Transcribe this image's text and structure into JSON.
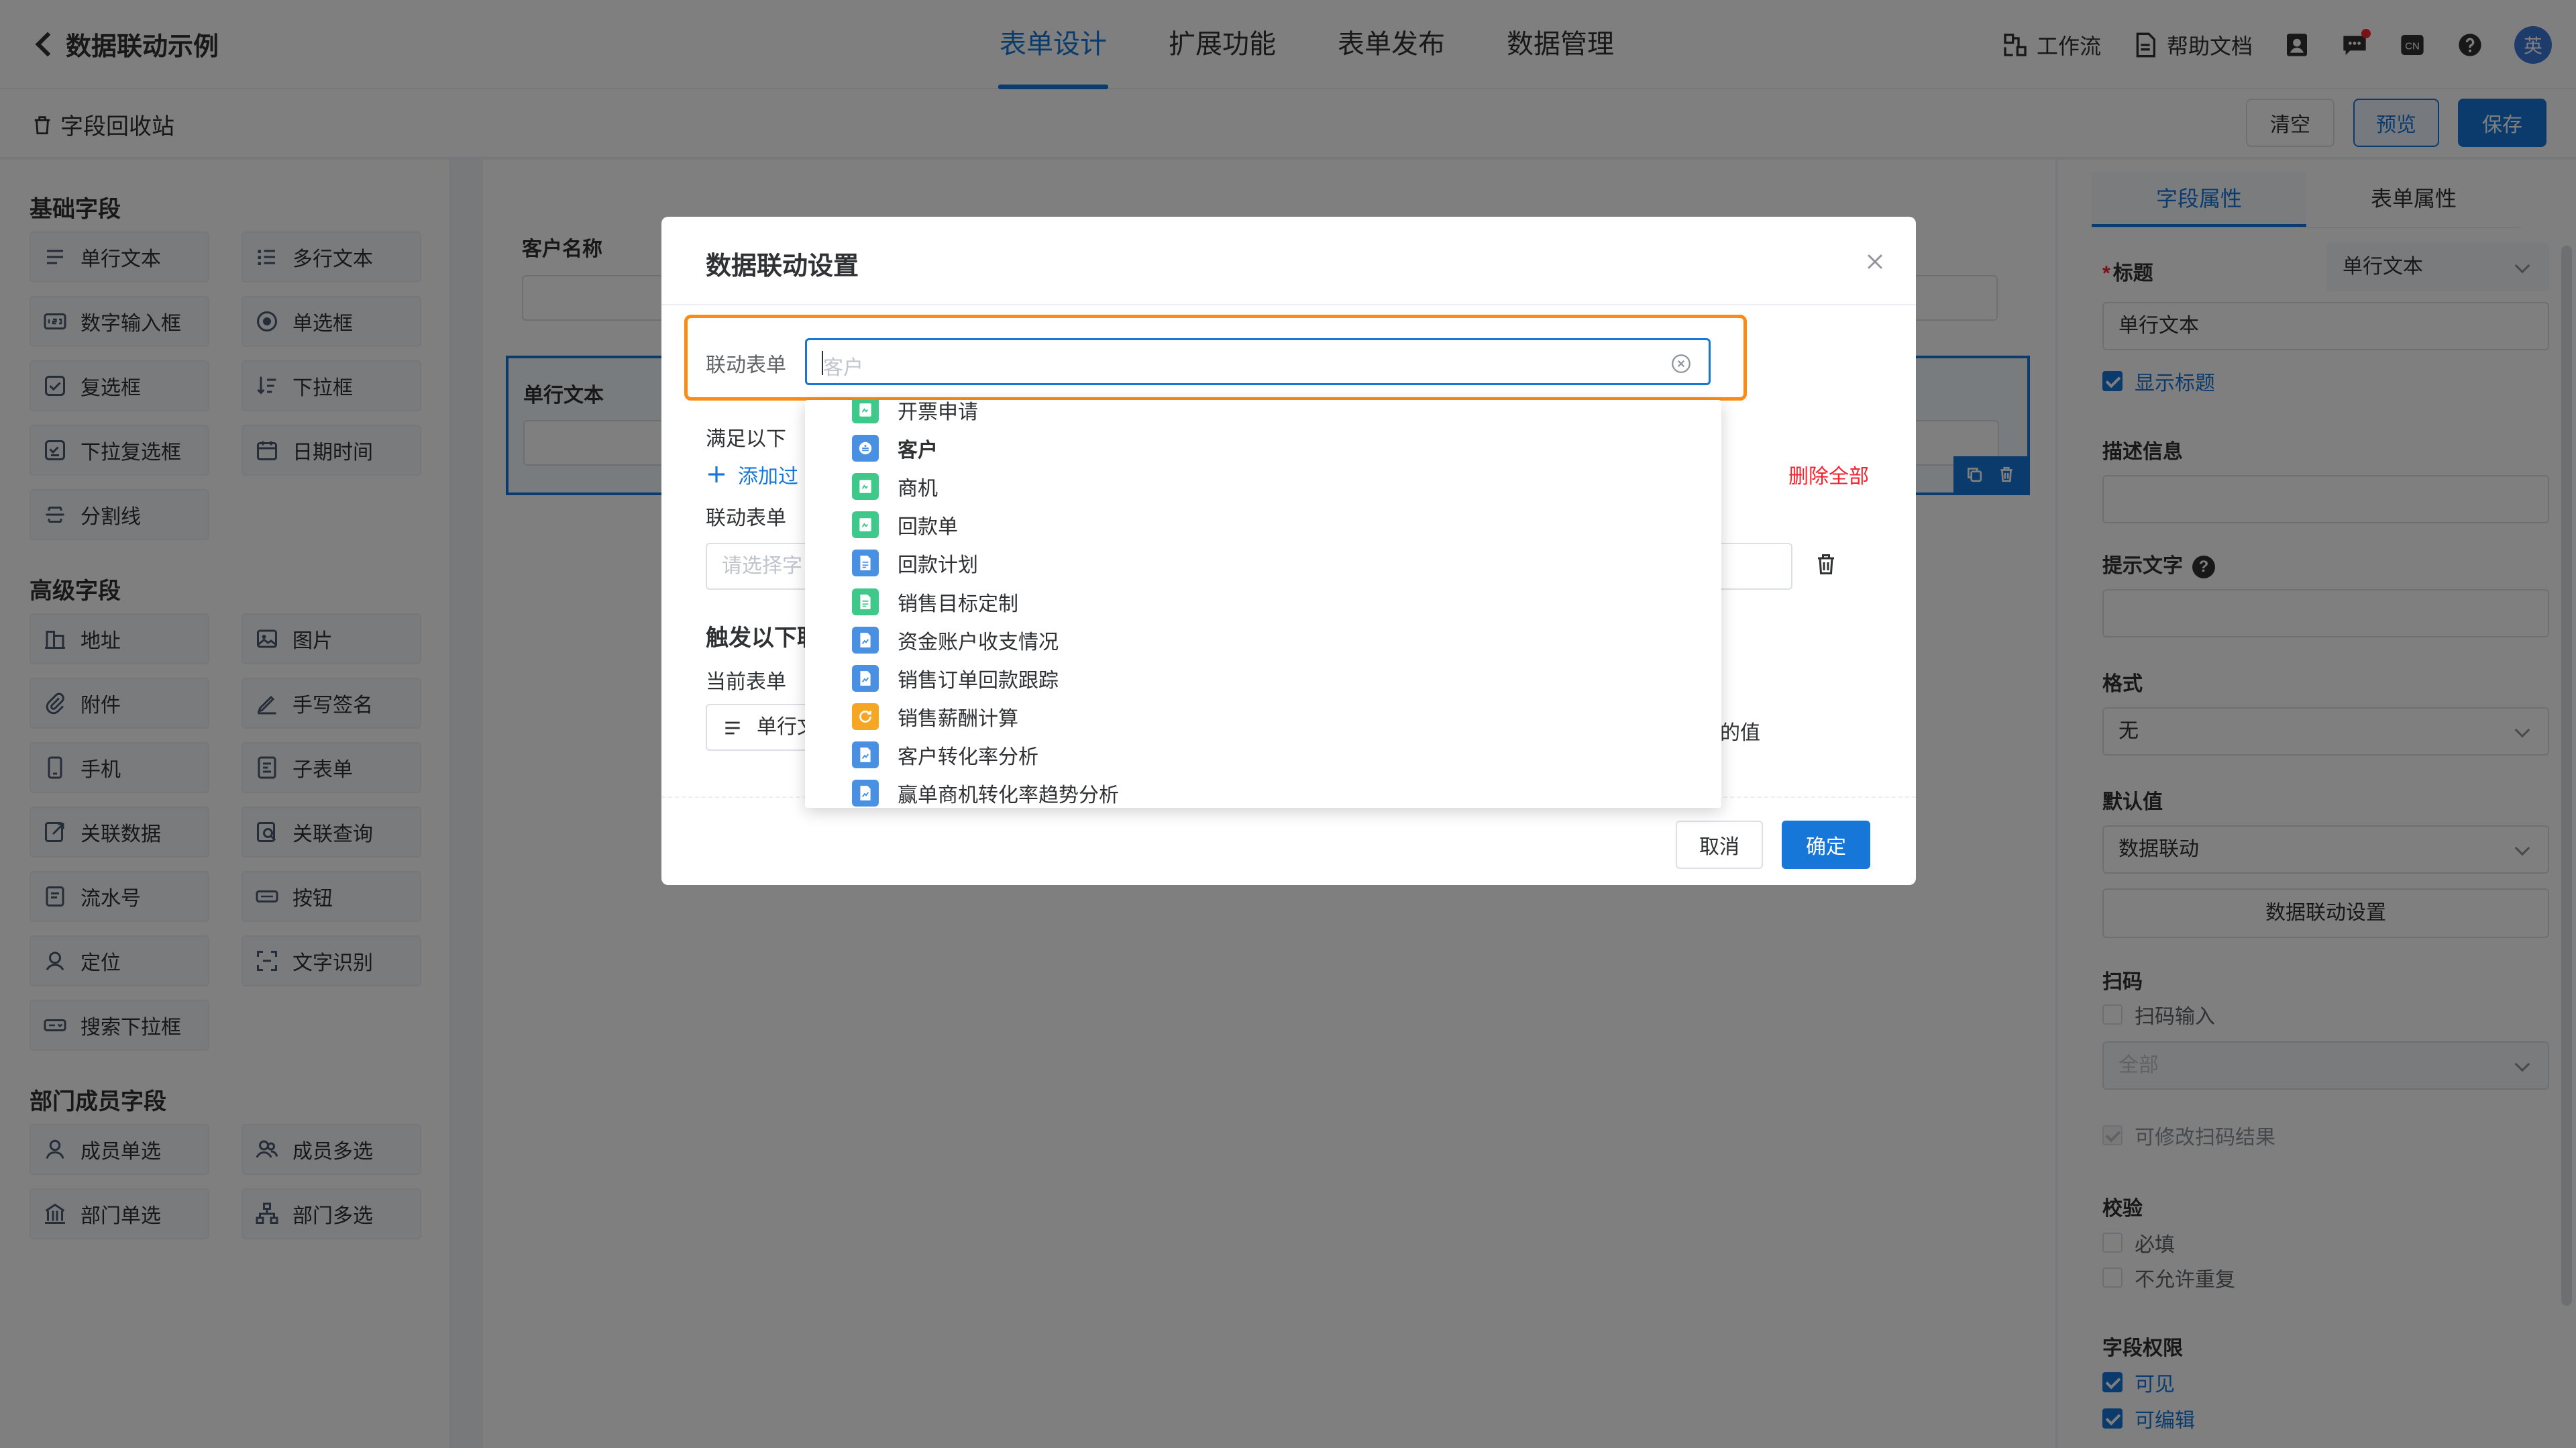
{
  "app": {
    "title": "数据联动示例"
  },
  "nav": {
    "tabs": [
      {
        "label": "表单设计",
        "active": true
      },
      {
        "label": "扩展功能",
        "active": false
      },
      {
        "label": "表单发布",
        "active": false
      },
      {
        "label": "数据管理",
        "active": false
      }
    ]
  },
  "tools": {
    "workflow": "工作流",
    "help_docs": "帮助文档",
    "avatar": "英",
    "lang": "CN"
  },
  "subbar": {
    "recycle": "字段回收站",
    "clear": "清空",
    "preview": "预览",
    "save": "保存"
  },
  "palette": {
    "basic_title": "基础字段",
    "basic": [
      "单行文本",
      "多行文本",
      "数字输入框",
      "单选框",
      "复选框",
      "下拉框",
      "下拉复选框",
      "日期时间",
      "分割线"
    ],
    "advanced_title": "高级字段",
    "advanced": [
      "地址",
      "图片",
      "附件",
      "手写签名",
      "手机",
      "子表单",
      "关联数据",
      "关联查询",
      "流水号",
      "按钮",
      "定位",
      "文字识别",
      "搜索下拉框"
    ],
    "member_title": "部门成员字段",
    "member": [
      "成员单选",
      "成员多选",
      "部门单选",
      "部门多选"
    ]
  },
  "canvas": {
    "field1_label": "客户名称",
    "field2_label": "单行文本"
  },
  "right_panel": {
    "tabs": [
      "字段属性",
      "表单属性"
    ],
    "title_label": "标题",
    "title_type": "单行文本",
    "title_value": "单行文本",
    "show_title": "显示标题",
    "desc_label": "描述信息",
    "hint_label": "提示文字",
    "format_label": "格式",
    "format_value": "无",
    "default_label": "默认值",
    "default_value": "数据联动",
    "linkage_button": "数据联动设置",
    "scan_label": "扫码",
    "scan_input": "扫码输入",
    "scan_scope": "全部",
    "scan_editable": "可修改扫码结果",
    "validate_label": "校验",
    "required": "必填",
    "no_duplicate": "不允许重复",
    "perm_label": "字段权限",
    "visible": "可见",
    "editable": "可编辑"
  },
  "modal": {
    "title": "数据联动设置",
    "link_form_label": "联动表单",
    "search_value": "客户",
    "satisfy_label": "满足以下",
    "add_filter": "添加过",
    "delete_all": "删除全部",
    "link_form_label2": "联动表单",
    "select_placeholder": "请选择字",
    "trigger_title": "触发以下联",
    "current_form": "当前表单",
    "current_field": "单行文",
    "value_suffix": "的值",
    "cancel": "取消",
    "ok": "确定"
  },
  "dropdown": {
    "items": [
      {
        "label": "开票申请",
        "color": "green",
        "icon": "form-icon",
        "bold": false
      },
      {
        "label": "客户",
        "color": "blue",
        "icon": "customer-icon",
        "bold": true
      },
      {
        "label": "商机",
        "color": "green",
        "icon": "form-icon",
        "bold": false
      },
      {
        "label": "回款单",
        "color": "green",
        "icon": "form-icon",
        "bold": false
      },
      {
        "label": "回款计划",
        "color": "blue",
        "icon": "doc-icon",
        "bold": false
      },
      {
        "label": "销售目标定制",
        "color": "green",
        "icon": "doc-icon",
        "bold": false
      },
      {
        "label": "资金账户收支情况",
        "color": "blue",
        "icon": "report-icon",
        "bold": false
      },
      {
        "label": "销售订单回款跟踪",
        "color": "blue",
        "icon": "report-icon",
        "bold": false
      },
      {
        "label": "销售薪酬计算",
        "color": "orange",
        "icon": "refresh-icon",
        "bold": false
      },
      {
        "label": "客户转化率分析",
        "color": "blue",
        "icon": "report-icon",
        "bold": false
      },
      {
        "label": "赢单商机转化率趋势分析",
        "color": "blue",
        "icon": "report-icon",
        "bold": false
      }
    ]
  },
  "colors": {
    "primary": "#1677d9",
    "highlight": "#fa8c16",
    "danger": "#f5222d"
  }
}
